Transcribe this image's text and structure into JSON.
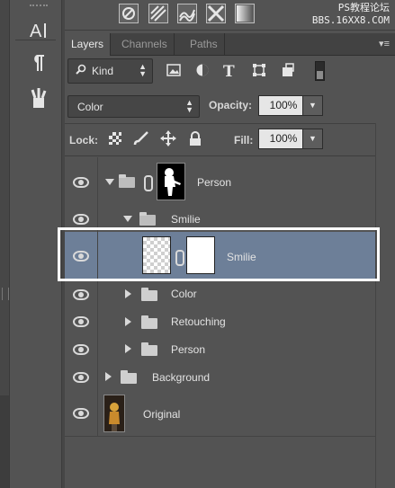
{
  "watermark": {
    "line1": "PS教程论坛",
    "line2": "BBS.16XX8.COM"
  },
  "tools": [
    {
      "icon": "character-panel-icon",
      "glyph": "A|"
    },
    {
      "icon": "paragraph-panel-icon",
      "glyph": "¶"
    },
    {
      "icon": "tool-presets-icon",
      "glyph": "⚒"
    }
  ],
  "adjustments": [
    "levels-adjustment-icon",
    "gradient-map-icon",
    "selective-color-icon",
    "channel-mixer-icon",
    "gradient-fill-icon"
  ],
  "panel": {
    "tabs": [
      {
        "label": "Layers",
        "active": true
      },
      {
        "label": "Channels",
        "active": false
      },
      {
        "label": "Paths",
        "active": false
      }
    ],
    "menu_glyph": "▾≡"
  },
  "filter": {
    "label": "Kind",
    "icons": [
      "image-filter-icon",
      "adjustment-filter-icon",
      "type-filter-icon",
      "shape-filter-icon",
      "smart-object-filter-icon"
    ]
  },
  "blend": {
    "mode": "Color",
    "opacity_label": "Opacity:",
    "opacity": "100%"
  },
  "lock": {
    "label": "Lock:",
    "fill_label": "Fill:",
    "fill": "100%"
  },
  "layers": [
    {
      "name": "Person",
      "type": "group-with-mask",
      "expanded": true,
      "indent": 0
    },
    {
      "name": "Smilie",
      "type": "group",
      "expanded": true,
      "indent": 1
    },
    {
      "name": "Smilie",
      "type": "layer-with-mask",
      "selected": true,
      "indent": 2
    },
    {
      "name": "Color",
      "type": "group",
      "expanded": false,
      "indent": 2
    },
    {
      "name": "Retouching",
      "type": "group",
      "expanded": false,
      "indent": 2
    },
    {
      "name": "Person",
      "type": "group",
      "expanded": false,
      "indent": 2
    },
    {
      "name": "Background",
      "type": "group",
      "expanded": false,
      "indent": 0
    },
    {
      "name": "Original",
      "type": "image",
      "indent": 0
    }
  ],
  "colors": {
    "panel_bg": "#535353",
    "selection": "#6d7f98",
    "highlight_frame": "#ffffff"
  }
}
